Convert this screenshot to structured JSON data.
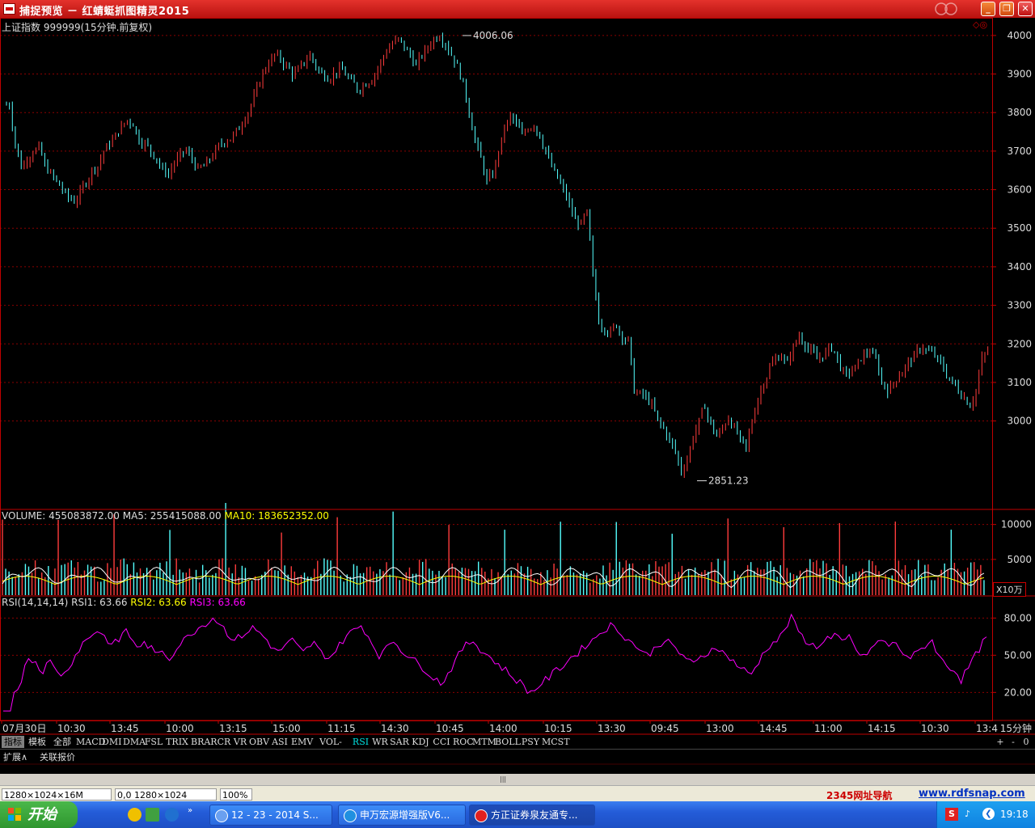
{
  "window": {
    "title": "捕捉预览 － 红蜻蜓抓图精灵2015",
    "min_icon": "minimize-icon",
    "max_icon": "maximize-icon",
    "close_icon": "close-icon"
  },
  "chart_header": {
    "symbol": "上证指数 999999(15分钟.前复权)"
  },
  "volume_header": {
    "vol": "VOLUME: 455083872.00",
    "ma5": "MA5: 255415088.00",
    "ma10": "MA10: 183652352.00",
    "unit": "X10万"
  },
  "rsi_header": {
    "name": "RSI(14,14,14)",
    "rsi1": "RSI1: 63.66",
    "rsi2": "RSI2: 63.66",
    "rsi3": "RSI3: 63.66"
  },
  "colors": {
    "up": "#ff3c3c",
    "down": "#54ffff",
    "grid": "#8b0000",
    "axis": "#c00000",
    "ma5": "#ffffff",
    "ma10": "#ffff00",
    "rsi": "#ff00ff"
  },
  "chart_data": [
    {
      "type": "candlestick",
      "ylim": [
        2800,
        4050
      ],
      "yticks": [
        3000,
        3100,
        3200,
        3300,
        3400,
        3500,
        3600,
        3700,
        3800,
        3900,
        4000
      ],
      "annotations": [
        {
          "label": "4006.06",
          "value": 4006.06
        },
        {
          "label": "2851.23",
          "value": 2851.23
        }
      ],
      "close_path": [
        3820,
        3720,
        3660,
        3680,
        3700,
        3710,
        3660,
        3640,
        3620,
        3600,
        3580,
        3570,
        3590,
        3620,
        3650,
        3660,
        3700,
        3720,
        3740,
        3760,
        3780,
        3770,
        3730,
        3720,
        3700,
        3680,
        3650,
        3640,
        3670,
        3690,
        3700,
        3680,
        3650,
        3660,
        3680,
        3700,
        3720,
        3730,
        3740,
        3760,
        3790,
        3820,
        3860,
        3900,
        3930,
        3950,
        3940,
        3920,
        3900,
        3910,
        3930,
        3950,
        3920,
        3900,
        3890,
        3900,
        3910,
        3900,
        3880,
        3860,
        3870,
        3880,
        3900,
        3930,
        3960,
        3980,
        3990,
        3970,
        3950,
        3920,
        3950,
        3970,
        3990,
        4000,
        3980,
        3950,
        3920,
        3870,
        3800,
        3730,
        3680,
        3620,
        3640,
        3700,
        3760,
        3790,
        3770,
        3740,
        3760,
        3770,
        3740,
        3700,
        3660,
        3630,
        3600,
        3560,
        3520,
        3510,
        3540,
        3380,
        3260,
        3240,
        3230,
        3250,
        3220,
        3210,
        3080,
        3070,
        3060,
        3040,
        3000,
        2980,
        2950,
        2920,
        2870,
        2900,
        2960,
        3000,
        3040,
        2990,
        2960,
        2980,
        3010,
        2980,
        2950,
        2930,
        3000,
        3060,
        3100,
        3140,
        3160,
        3170,
        3150,
        3190,
        3220,
        3200,
        3180,
        3160,
        3170,
        3190,
        3180,
        3140,
        3120,
        3130,
        3150,
        3170,
        3180,
        3160,
        3100,
        3080,
        3100,
        3120,
        3140,
        3160,
        3180,
        3190,
        3180,
        3170,
        3150,
        3120,
        3100,
        3080,
        3060,
        3040,
        3080,
        3160,
        3180
      ],
      "xticks": [
        "07月30日",
        "10:30",
        "13:45",
        "10:00",
        "13:15",
        "15:00",
        "11:15",
        "14:30",
        "10:45",
        "14:00",
        "10:15",
        "13:30",
        "09:45",
        "13:00",
        "14:45",
        "11:00",
        "14:15",
        "10:30",
        "13:4"
      ],
      "period": "15分钟"
    },
    {
      "type": "bar",
      "name": "VOLUME",
      "ylim": [
        0,
        11000
      ],
      "yticks": [
        5000,
        10000
      ]
    },
    {
      "type": "line",
      "name": "RSI",
      "ylim": [
        0,
        90
      ],
      "yticks": [
        "20.00",
        "50.00",
        "80.00"
      ],
      "values": [
        5,
        5,
        5,
        20,
        25,
        30,
        40,
        50,
        45,
        45,
        40,
        38,
        42,
        45,
        40,
        38,
        35,
        35,
        40,
        45,
        50,
        55,
        60,
        62,
        65,
        68,
        70,
        68,
        65,
        62,
        58,
        60,
        62,
        68,
        70,
        65,
        62,
        58,
        55,
        60,
        58,
        55,
        50,
        52,
        55,
        50,
        48,
        52,
        55,
        60,
        62,
        65,
        68,
        70,
        72,
        74,
        76,
        78,
        80,
        78,
        76,
        72,
        68,
        65,
        62,
        64,
        66,
        68,
        70,
        72,
        70,
        68,
        65,
        62,
        58,
        55,
        52,
        55,
        58,
        60,
        62,
        58,
        55,
        52,
        55,
        58,
        60,
        55,
        52,
        50,
        48,
        50,
        55,
        58,
        62,
        66,
        68,
        70,
        72,
        74,
        70,
        65,
        60,
        55,
        50,
        52,
        55,
        60,
        62,
        58,
        55,
        52,
        50,
        48,
        45,
        42,
        40,
        38,
        35,
        32,
        30,
        28,
        30,
        35,
        40,
        45,
        50,
        55,
        58,
        60,
        62,
        58,
        55,
        52,
        50,
        48,
        45,
        42,
        40,
        38,
        35,
        32,
        30,
        28,
        25,
        22,
        20,
        22,
        25,
        28,
        30,
        32,
        35,
        38,
        40,
        42,
        45,
        48,
        50,
        52,
        55,
        58,
        60,
        62,
        65,
        68,
        70,
        72,
        74,
        72,
        70,
        68,
        65,
        62,
        60,
        58,
        55,
        52,
        50,
        52,
        55,
        58,
        60,
        62,
        60,
        58,
        55,
        52,
        50,
        48,
        45,
        42,
        45,
        48,
        50,
        52,
        55,
        58,
        55,
        52,
        50,
        48,
        45,
        42,
        40,
        38,
        35,
        35,
        40,
        45,
        50,
        55,
        58,
        60,
        62,
        65,
        70,
        75,
        80,
        75,
        70,
        65,
        62,
        60,
        58,
        55,
        60,
        62,
        64,
        63,
        66,
        63,
        60,
        62,
        65,
        60,
        55,
        50,
        48,
        52,
        55,
        58,
        60,
        62,
        60,
        58,
        60,
        58,
        55,
        52,
        50,
        48,
        50,
        52,
        55,
        58,
        60,
        62,
        55,
        48,
        45,
        42,
        40,
        38,
        35,
        30,
        35,
        40,
        45,
        50,
        55,
        60,
        63
      ]
    }
  ],
  "tabs": [
    "指标",
    "模板",
    "全部",
    "MACD",
    "DMI",
    "DMA",
    "FSL",
    "TRIX",
    "BRAR",
    "CR",
    "VR",
    "OBV",
    "ASI",
    "EMV",
    "VOL-TDX",
    "RSI",
    "WR",
    "SAR",
    "KDJ",
    "CCI",
    "ROC",
    "MTM",
    "BOLL",
    "PSY",
    "MCST"
  ],
  "tab_controls": [
    "+",
    "-",
    "0"
  ],
  "row2": [
    "扩展∧",
    "关联报价"
  ],
  "statusbar": {
    "info1": "1280×1024×16M",
    "info2": "0,0 1280×1024",
    "info3": "100%",
    "link1": "2345网址导航",
    "link2": "www.rdfsnap.com"
  },
  "taskbar": {
    "start": "开始",
    "tasks": [
      "12 - 23 - 2014 S...",
      "申万宏源增强版V6...",
      "方正证券泉友通专..."
    ],
    "clock": "19:18"
  }
}
